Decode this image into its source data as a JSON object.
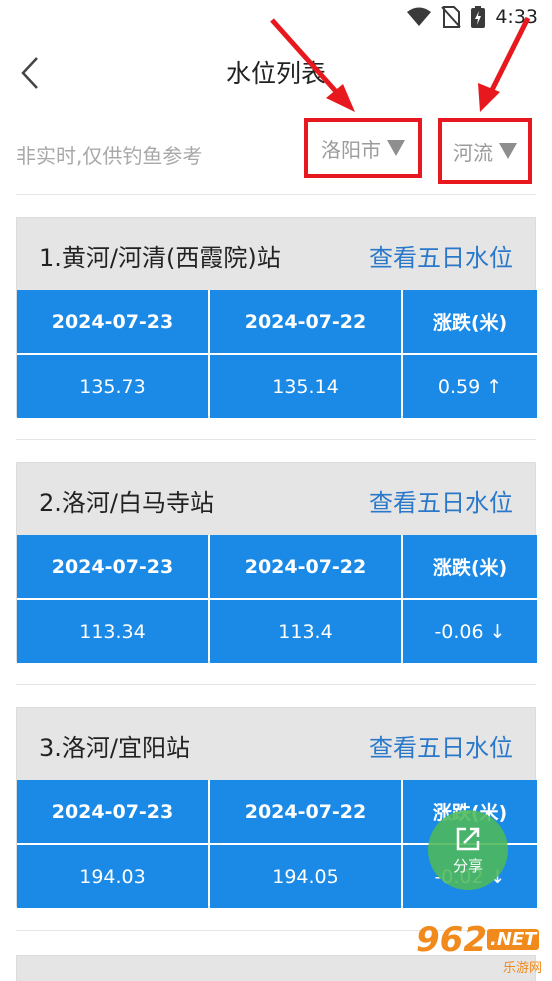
{
  "status_bar": {
    "time": "4:33"
  },
  "header": {
    "title": "水位列表"
  },
  "filters": {
    "disclaimer": "非实时,仅供钓鱼参考",
    "city": "洛阳市",
    "river": "河流"
  },
  "view_link": "查看五日水位",
  "table_headers": {
    "date1": "2024-07-23",
    "date2": "2024-07-22",
    "change": "涨跌(米)"
  },
  "stations": [
    {
      "name": "1.黄河/河清(西霞院)站",
      "value1": "135.73",
      "value2": "135.14",
      "change": "0.59 ↑"
    },
    {
      "name": "2.洛河/白马寺站",
      "value1": "113.34",
      "value2": "113.4",
      "change": "-0.06 ↓"
    },
    {
      "name": "3.洛河/宜阳站",
      "value1": "194.03",
      "value2": "194.05",
      "change": "-0.02 ↓"
    }
  ],
  "share": {
    "label": "分享"
  },
  "watermark": {
    "logo": "962",
    "net": ".NET",
    "sub": "乐游网"
  },
  "colors": {
    "accent": "#1b8ae6",
    "link": "#2a78c9",
    "annotation": "#e8191e",
    "share": "#4fb85a"
  }
}
